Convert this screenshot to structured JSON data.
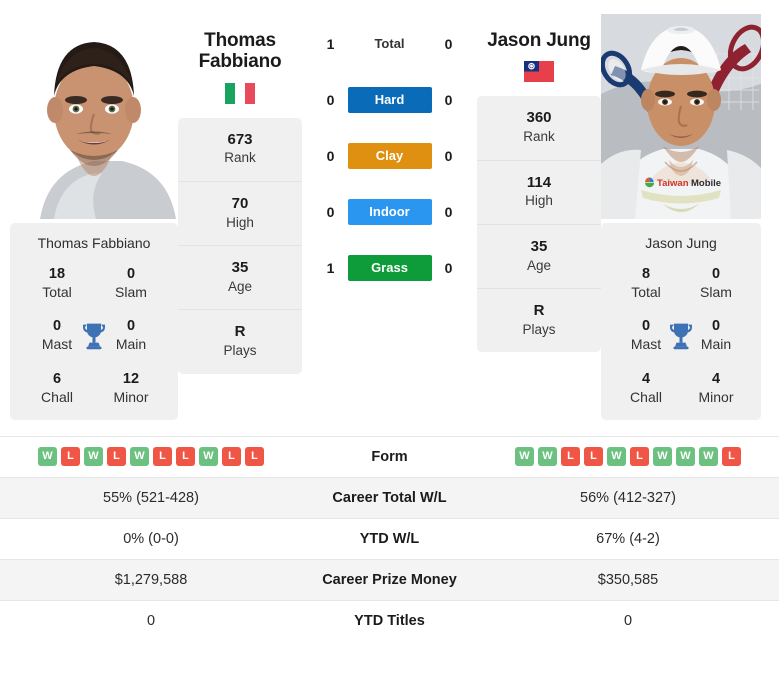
{
  "players": {
    "left": {
      "name_line1": "Thomas",
      "name_line2": "Fabbiano",
      "full_name": "Thomas Fabbiano",
      "flag": "italy-flag",
      "photo": "thomas-fabbiano-headshot",
      "stats": [
        {
          "value": "673",
          "label": "Rank"
        },
        {
          "value": "70",
          "label": "High"
        },
        {
          "value": "35",
          "label": "Age"
        },
        {
          "value": "R",
          "label": "Plays"
        }
      ],
      "titles": [
        {
          "value": "18",
          "label": "Total"
        },
        {
          "value": "0",
          "label": "Slam"
        },
        {
          "value": "0",
          "label": "Mast"
        },
        {
          "value": "0",
          "label": "Main"
        },
        {
          "value": "6",
          "label": "Chall"
        },
        {
          "value": "12",
          "label": "Minor"
        }
      ],
      "form": [
        "W",
        "L",
        "W",
        "L",
        "W",
        "L",
        "L",
        "W",
        "L",
        "L"
      ]
    },
    "right": {
      "name_line1": "Jason Jung",
      "name_line2": "",
      "full_name": "Jason Jung",
      "flag": "taiwan-flag",
      "photo": "jason-jung-headshot",
      "stats": [
        {
          "value": "360",
          "label": "Rank"
        },
        {
          "value": "114",
          "label": "High"
        },
        {
          "value": "35",
          "label": "Age"
        },
        {
          "value": "R",
          "label": "Plays"
        }
      ],
      "titles": [
        {
          "value": "8",
          "label": "Total"
        },
        {
          "value": "0",
          "label": "Slam"
        },
        {
          "value": "0",
          "label": "Mast"
        },
        {
          "value": "0",
          "label": "Main"
        },
        {
          "value": "4",
          "label": "Chall"
        },
        {
          "value": "4",
          "label": "Minor"
        }
      ],
      "form": [
        "W",
        "W",
        "L",
        "L",
        "W",
        "L",
        "W",
        "W",
        "W",
        "L"
      ]
    }
  },
  "head_to_head": [
    {
      "label": "Total",
      "left": "1",
      "right": "0",
      "color": "",
      "style": "plain"
    },
    {
      "label": "Hard",
      "left": "0",
      "right": "0",
      "color": "#0a6cb8",
      "style": "filled"
    },
    {
      "label": "Clay",
      "left": "0",
      "right": "0",
      "color": "#e09010",
      "style": "filled"
    },
    {
      "label": "Indoor",
      "left": "0",
      "right": "0",
      "color": "#2a96f0",
      "style": "filled"
    },
    {
      "label": "Grass",
      "left": "1",
      "right": "0",
      "color": "#0e9c3a",
      "style": "filled"
    }
  ],
  "table": {
    "form_label": "Form",
    "rows": [
      {
        "label": "Career Total W/L",
        "left": "55% (521-428)",
        "right": "56% (412-327)"
      },
      {
        "label": "YTD W/L",
        "left": "0% (0-0)",
        "right": "67% (4-2)"
      },
      {
        "label": "Career Prize Money",
        "left": "$1,279,588",
        "right": "$350,585"
      },
      {
        "label": "YTD Titles",
        "left": "0",
        "right": "0"
      }
    ]
  },
  "colors": {
    "win_badge": "#6cc080",
    "loss_badge": "#ef5646",
    "card_bg": "#f0f0f0",
    "stripe": "#f4f4f4",
    "trophy": "#3e72b4"
  }
}
